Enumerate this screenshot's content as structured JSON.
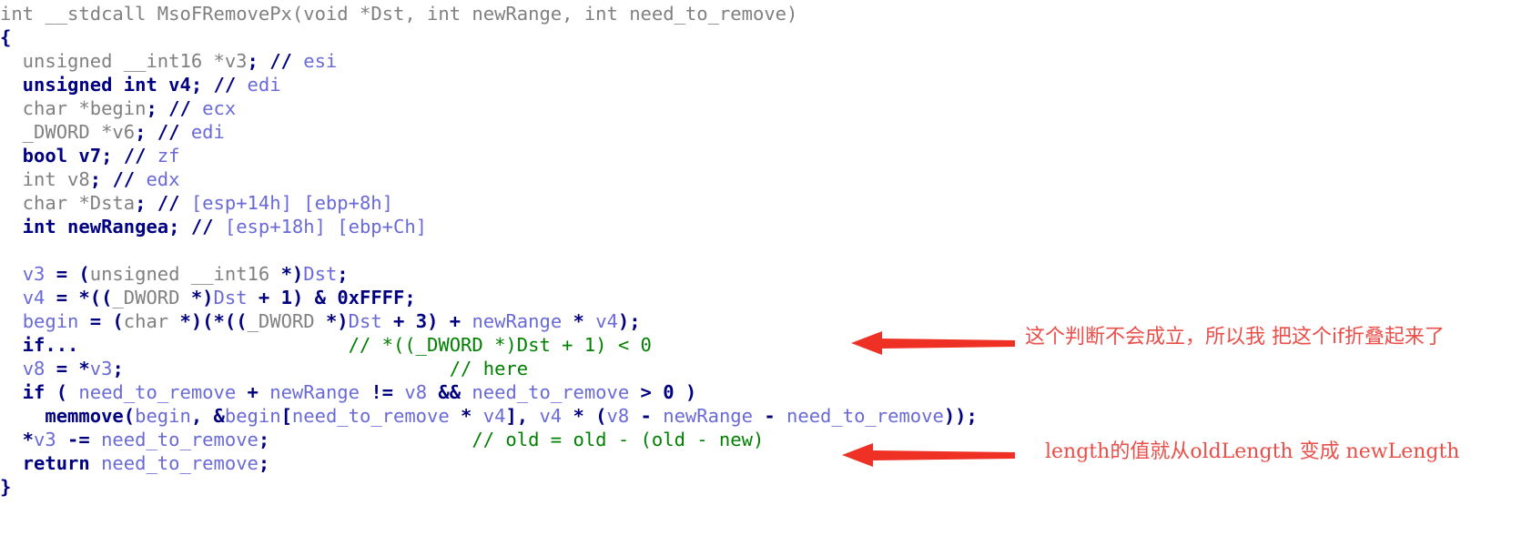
{
  "app": {
    "view": "hex-rays-pseudocode",
    "background_color": "#ffffff"
  },
  "colors": {
    "keyword": "#000080",
    "plain": "#808080",
    "variable": "#6a6ad6",
    "comment": "#008000",
    "annotation_red": "#e8403a"
  },
  "code": {
    "language": "c-pseudocode",
    "lines": [
      {
        "index": 0,
        "tokens": [
          {
            "t": "int ",
            "c": "plain"
          },
          {
            "t": "__stdcall ",
            "c": "plain"
          },
          {
            "t": "MsoFRemovePx",
            "c": "plain"
          },
          {
            "t": "(",
            "c": "plain"
          },
          {
            "t": "void ",
            "c": "plain"
          },
          {
            "t": "*",
            "c": "plain"
          },
          {
            "t": "Dst",
            "c": "plain"
          },
          {
            "t": ", ",
            "c": "plain"
          },
          {
            "t": "int ",
            "c": "plain"
          },
          {
            "t": "newRange",
            "c": "plain"
          },
          {
            "t": ", ",
            "c": "plain"
          },
          {
            "t": "int ",
            "c": "plain"
          },
          {
            "t": "need_to_remove",
            "c": "plain"
          },
          {
            "t": ")",
            "c": "plain"
          }
        ]
      },
      {
        "index": 1,
        "tokens": [
          {
            "t": "{",
            "c": "keyword"
          }
        ]
      },
      {
        "index": 2,
        "tokens": [
          {
            "t": "  unsigned __int16 ",
            "c": "plain"
          },
          {
            "t": "*",
            "c": "plain"
          },
          {
            "t": "v3",
            "c": "plain"
          },
          {
            "t": ";",
            "c": "keyword"
          },
          {
            "t": " ",
            "c": "plain"
          },
          {
            "t": "//",
            "c": "keyword"
          },
          {
            "t": " esi",
            "c": "variable"
          }
        ]
      },
      {
        "index": 3,
        "tokens": [
          {
            "t": "  unsigned int ",
            "c": "keyword"
          },
          {
            "t": "v4",
            "c": "keyword"
          },
          {
            "t": ";",
            "c": "keyword"
          },
          {
            "t": " ",
            "c": "plain"
          },
          {
            "t": "//",
            "c": "keyword"
          },
          {
            "t": " edi",
            "c": "variable"
          }
        ]
      },
      {
        "index": 4,
        "tokens": [
          {
            "t": "  char *begin",
            "c": "plain"
          },
          {
            "t": ";",
            "c": "keyword"
          },
          {
            "t": " ",
            "c": "plain"
          },
          {
            "t": "//",
            "c": "keyword"
          },
          {
            "t": " ecx",
            "c": "variable"
          }
        ]
      },
      {
        "index": 5,
        "tokens": [
          {
            "t": "  _DWORD *v6",
            "c": "plain"
          },
          {
            "t": ";",
            "c": "keyword"
          },
          {
            "t": " ",
            "c": "plain"
          },
          {
            "t": "//",
            "c": "keyword"
          },
          {
            "t": " edi",
            "c": "variable"
          }
        ]
      },
      {
        "index": 6,
        "tokens": [
          {
            "t": "  bool v7",
            "c": "keyword"
          },
          {
            "t": ";",
            "c": "keyword"
          },
          {
            "t": " ",
            "c": "plain"
          },
          {
            "t": "//",
            "c": "keyword"
          },
          {
            "t": " zf",
            "c": "variable"
          }
        ]
      },
      {
        "index": 7,
        "tokens": [
          {
            "t": "  int v8",
            "c": "plain"
          },
          {
            "t": ";",
            "c": "keyword"
          },
          {
            "t": " ",
            "c": "plain"
          },
          {
            "t": "//",
            "c": "keyword"
          },
          {
            "t": " edx",
            "c": "variable"
          }
        ]
      },
      {
        "index": 8,
        "tokens": [
          {
            "t": "  char *Dsta",
            "c": "plain"
          },
          {
            "t": ";",
            "c": "keyword"
          },
          {
            "t": " ",
            "c": "plain"
          },
          {
            "t": "//",
            "c": "keyword"
          },
          {
            "t": " [esp+14h] [ebp+8h]",
            "c": "variable"
          }
        ]
      },
      {
        "index": 9,
        "tokens": [
          {
            "t": "  int newRangea",
            "c": "keyword"
          },
          {
            "t": ";",
            "c": "keyword"
          },
          {
            "t": " ",
            "c": "plain"
          },
          {
            "t": "//",
            "c": "keyword"
          },
          {
            "t": " [esp+18h] [ebp+Ch]",
            "c": "variable"
          }
        ]
      },
      {
        "index": 10,
        "tokens": []
      },
      {
        "index": 11,
        "tokens": [
          {
            "t": "  ",
            "c": "plain"
          },
          {
            "t": "v3",
            "c": "variable"
          },
          {
            "t": " = ",
            "c": "keyword"
          },
          {
            "t": "(",
            "c": "keyword"
          },
          {
            "t": "unsigned __int16 ",
            "c": "plain"
          },
          {
            "t": "*)",
            "c": "keyword"
          },
          {
            "t": "Dst",
            "c": "variable"
          },
          {
            "t": ";",
            "c": "keyword"
          }
        ]
      },
      {
        "index": 12,
        "tokens": [
          {
            "t": "  ",
            "c": "plain"
          },
          {
            "t": "v4",
            "c": "variable"
          },
          {
            "t": " = *((",
            "c": "keyword"
          },
          {
            "t": "_DWORD ",
            "c": "plain"
          },
          {
            "t": "*)",
            "c": "keyword"
          },
          {
            "t": "Dst",
            "c": "variable"
          },
          {
            "t": " + ",
            "c": "keyword"
          },
          {
            "t": "1",
            "c": "keyword"
          },
          {
            "t": ") & ",
            "c": "keyword"
          },
          {
            "t": "0xFFFF",
            "c": "keyword"
          },
          {
            "t": ";",
            "c": "keyword"
          }
        ]
      },
      {
        "index": 13,
        "tokens": [
          {
            "t": "  ",
            "c": "plain"
          },
          {
            "t": "begin",
            "c": "variable"
          },
          {
            "t": " = (",
            "c": "keyword"
          },
          {
            "t": "char ",
            "c": "plain"
          },
          {
            "t": "*)(*((",
            "c": "keyword"
          },
          {
            "t": "_DWORD ",
            "c": "plain"
          },
          {
            "t": "*)",
            "c": "keyword"
          },
          {
            "t": "Dst",
            "c": "variable"
          },
          {
            "t": " + ",
            "c": "keyword"
          },
          {
            "t": "3",
            "c": "keyword"
          },
          {
            "t": ") + ",
            "c": "keyword"
          },
          {
            "t": "newRange",
            "c": "variable"
          },
          {
            "t": " * ",
            "c": "keyword"
          },
          {
            "t": "v4",
            "c": "variable"
          },
          {
            "t": ");",
            "c": "keyword"
          }
        ]
      },
      {
        "index": 14,
        "tokens": [
          {
            "t": "  if...",
            "c": "keyword"
          },
          {
            "t": "                        ",
            "c": "plain"
          },
          {
            "t": "// *((_DWORD *)Dst + 1) < 0",
            "c": "comment"
          }
        ]
      },
      {
        "index": 15,
        "tokens": [
          {
            "t": "  ",
            "c": "plain"
          },
          {
            "t": "v8",
            "c": "variable"
          },
          {
            "t": " = *",
            "c": "keyword"
          },
          {
            "t": "v3",
            "c": "variable"
          },
          {
            "t": ";",
            "c": "keyword"
          },
          {
            "t": "                             ",
            "c": "plain"
          },
          {
            "t": "// here",
            "c": "comment"
          }
        ]
      },
      {
        "index": 16,
        "tokens": [
          {
            "t": "  if ( ",
            "c": "keyword"
          },
          {
            "t": "need_to_remove",
            "c": "variable"
          },
          {
            "t": " + ",
            "c": "keyword"
          },
          {
            "t": "newRange",
            "c": "variable"
          },
          {
            "t": " != ",
            "c": "keyword"
          },
          {
            "t": "v8",
            "c": "variable"
          },
          {
            "t": " && ",
            "c": "keyword"
          },
          {
            "t": "need_to_remove",
            "c": "variable"
          },
          {
            "t": " > ",
            "c": "keyword"
          },
          {
            "t": "0",
            "c": "keyword"
          },
          {
            "t": " )",
            "c": "keyword"
          }
        ]
      },
      {
        "index": 17,
        "tokens": [
          {
            "t": "    memmove",
            "c": "keyword"
          },
          {
            "t": "(",
            "c": "keyword"
          },
          {
            "t": "begin",
            "c": "variable"
          },
          {
            "t": ", &",
            "c": "keyword"
          },
          {
            "t": "begin",
            "c": "variable"
          },
          {
            "t": "[",
            "c": "keyword"
          },
          {
            "t": "need_to_remove",
            "c": "variable"
          },
          {
            "t": " * ",
            "c": "keyword"
          },
          {
            "t": "v4",
            "c": "variable"
          },
          {
            "t": "], ",
            "c": "keyword"
          },
          {
            "t": "v4",
            "c": "variable"
          },
          {
            "t": " * (",
            "c": "keyword"
          },
          {
            "t": "v8",
            "c": "variable"
          },
          {
            "t": " - ",
            "c": "keyword"
          },
          {
            "t": "newRange",
            "c": "variable"
          },
          {
            "t": " - ",
            "c": "keyword"
          },
          {
            "t": "need_to_remove",
            "c": "variable"
          },
          {
            "t": "));",
            "c": "keyword"
          }
        ]
      },
      {
        "index": 18,
        "tokens": [
          {
            "t": "  *",
            "c": "keyword"
          },
          {
            "t": "v3",
            "c": "variable"
          },
          {
            "t": " -= ",
            "c": "keyword"
          },
          {
            "t": "need_to_remove",
            "c": "variable"
          },
          {
            "t": ";",
            "c": "keyword"
          },
          {
            "t": "                  ",
            "c": "plain"
          },
          {
            "t": "// old = old - (old - new)",
            "c": "comment"
          }
        ]
      },
      {
        "index": 19,
        "tokens": [
          {
            "t": "  return ",
            "c": "keyword"
          },
          {
            "t": "need_to_remove",
            "c": "variable"
          },
          {
            "t": ";",
            "c": "keyword"
          }
        ]
      },
      {
        "index": 20,
        "tokens": [
          {
            "t": "}",
            "c": "keyword"
          }
        ]
      }
    ]
  },
  "annotations": [
    {
      "id": "annotation-if-collapsed",
      "text": "这个判断不会成立，所以我 把这个if折叠起来了",
      "color": "#e8403a",
      "arrow": "left-pointing-red-arrow",
      "near_line": 14
    },
    {
      "id": "annotation-length-change",
      "text": "length的值就从oldLength 变成 newLength",
      "color": "#e8403a",
      "arrow": "left-pointing-red-arrow",
      "near_line": 18
    }
  ]
}
